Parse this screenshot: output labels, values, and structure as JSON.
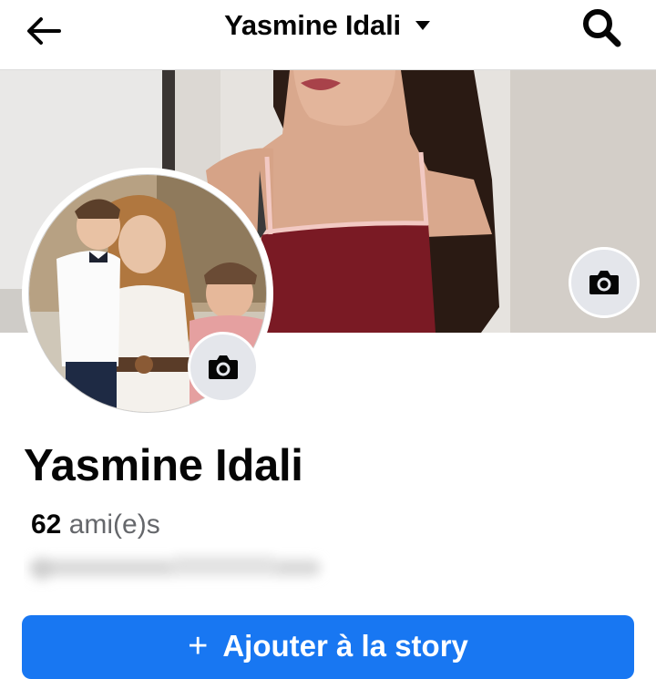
{
  "header": {
    "back_icon": "arrow-left-icon",
    "title": "Yasmine Idali",
    "dropdown_icon": "caret-down-icon",
    "search_icon": "search-icon"
  },
  "cover": {
    "edit_icon": "camera-icon"
  },
  "profile": {
    "avatar_edit_icon": "camera-icon",
    "name": "Yasmine Idali",
    "friends_count": "62",
    "friends_label": "ami(e)s"
  },
  "actions": {
    "add_story_icon": "plus-icon",
    "add_story_label": "Ajouter à la story"
  },
  "colors": {
    "primary": "#1877f2",
    "text": "#050505",
    "secondary_text": "#65676b",
    "icon_bg": "#e4e6eb"
  }
}
